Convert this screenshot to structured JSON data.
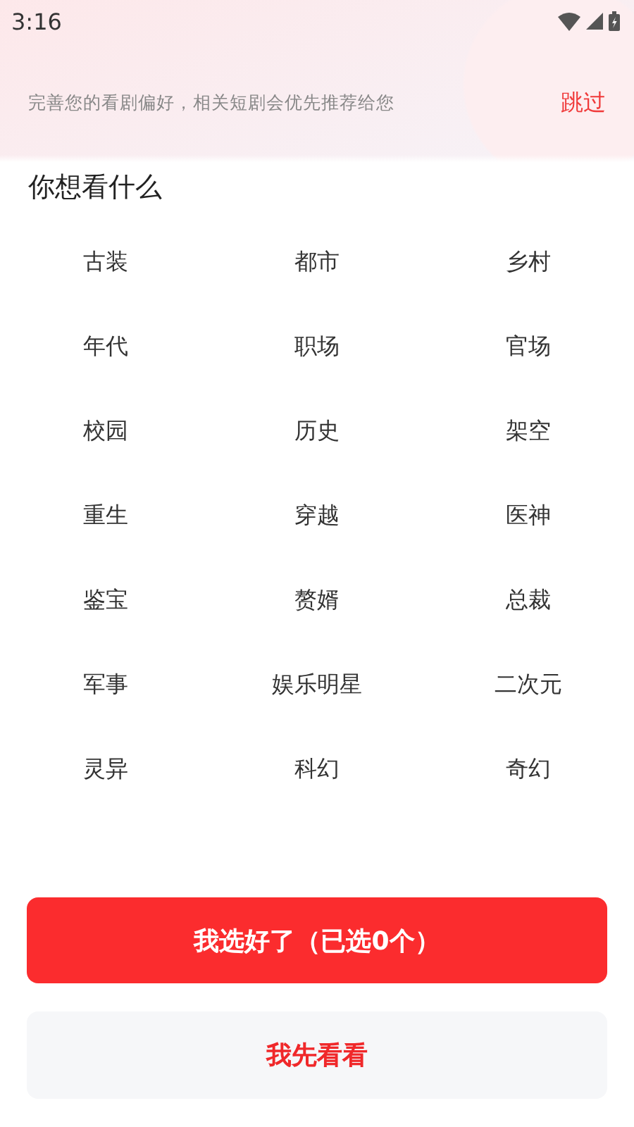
{
  "status_bar": {
    "time": "3:16"
  },
  "header": {
    "subtitle": "完善您的看剧偏好，相关短剧会优先推荐给您",
    "skip": "跳过"
  },
  "section_title": "你想看什么",
  "tags": [
    {
      "label": "古装",
      "selected": false
    },
    {
      "label": "都市",
      "selected": false
    },
    {
      "label": "乡村",
      "selected": false
    },
    {
      "label": "年代",
      "selected": false
    },
    {
      "label": "职场",
      "selected": false
    },
    {
      "label": "官场",
      "selected": false
    },
    {
      "label": "校园",
      "selected": false
    },
    {
      "label": "历史",
      "selected": false
    },
    {
      "label": "架空",
      "selected": false
    },
    {
      "label": "重生",
      "selected": false
    },
    {
      "label": "穿越",
      "selected": false
    },
    {
      "label": "医神",
      "selected": false
    },
    {
      "label": "鉴宝",
      "selected": false
    },
    {
      "label": "赘婿",
      "selected": false
    },
    {
      "label": "总裁",
      "selected": false
    },
    {
      "label": "军事",
      "selected": false
    },
    {
      "label": "娱乐明星",
      "selected": false
    },
    {
      "label": "二次元",
      "selected": false
    },
    {
      "label": "灵异",
      "selected": false
    },
    {
      "label": "科幻",
      "selected": false
    },
    {
      "label": "奇幻",
      "selected": false
    }
  ],
  "buttons": {
    "confirm": "我选好了（已选0个）",
    "later": "我先看看"
  }
}
